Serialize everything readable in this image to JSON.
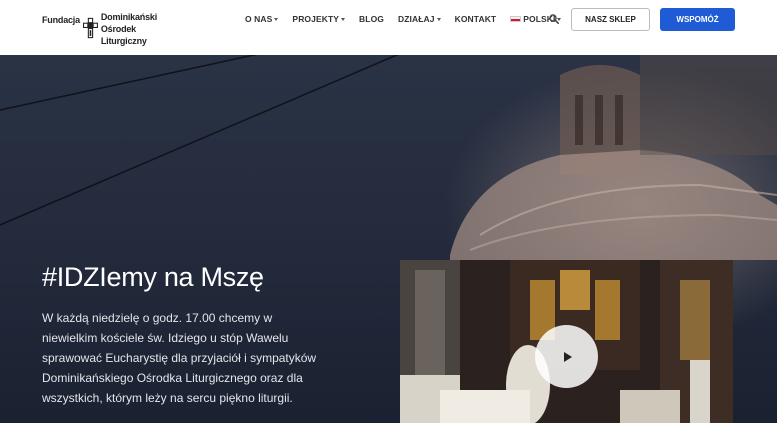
{
  "header": {
    "logo": {
      "left_text": "Fundacja",
      "right_lines": [
        "Dominikański",
        "Ośrodek",
        "Liturgiczny"
      ]
    },
    "nav": [
      {
        "label": "O nas",
        "dropdown": true
      },
      {
        "label": "Projekty",
        "dropdown": true
      },
      {
        "label": "Blog",
        "dropdown": false
      },
      {
        "label": "Działaj",
        "dropdown": true
      },
      {
        "label": "Kontakt",
        "dropdown": false
      },
      {
        "label": "Polski",
        "dropdown": true,
        "flag": "pl"
      }
    ],
    "search_icon": "search-icon",
    "shop_button": "Nasz sklep",
    "support_button": "Wspomóż",
    "support_color": "#1e5bd4"
  },
  "hero": {
    "title": "#IDZIemy na Mszę",
    "text": "W każdą niedzielę o godz. 17.00 chcemy w niewielkim kościele św. Idziego u stóp Wawelu sprawować Eucharystię dla przyjaciół i sympatyków Dominikańskiego Ośrodka Liturgicznego oraz dla wszystkich, którym leży na sercu piękno liturgii.",
    "video": {
      "play_icon": "play-icon"
    }
  }
}
